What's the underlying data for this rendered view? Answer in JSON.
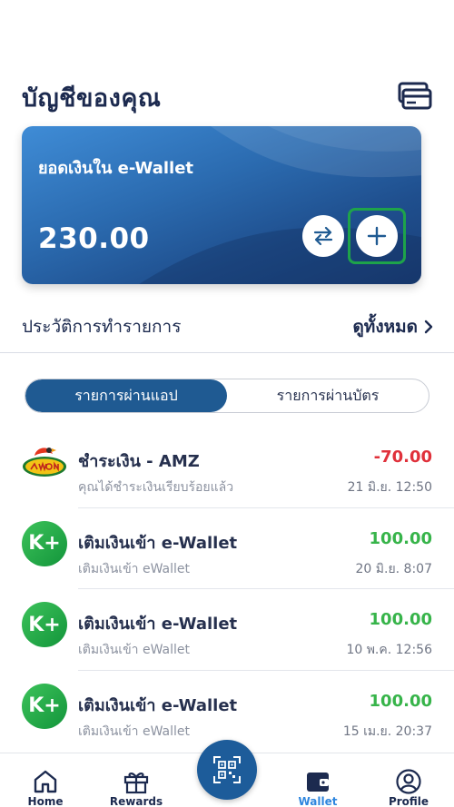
{
  "header": {
    "title": "บัญชีของคุณ",
    "cards_icon": "credit-cards-icon"
  },
  "wallet_card": {
    "label": "ยอดเงินใน e-Wallet",
    "balance": "230.00",
    "transfer_icon": "transfer-arrows-icon",
    "topup_icon": "plus-icon"
  },
  "history": {
    "title": "ประวัติการทำรายการ",
    "see_all": "ดูทั้งหมด"
  },
  "tabs": [
    {
      "label": "รายการผ่านแอป",
      "active": true
    },
    {
      "label": "รายการผ่านบัตร",
      "active": false
    }
  ],
  "transactions": [
    {
      "logo": "amazon-cafe-logo",
      "title": "ชำระเงิน - AMZ",
      "subtitle": "คุณได้ชำระเงินเรียบร้อยแล้ว",
      "amount": "-70.00",
      "type": "negative",
      "date": "21 มิ.ย. 12:50"
    },
    {
      "logo": "kplus-logo",
      "title": "เติมเงินเข้า e-Wallet",
      "subtitle": "เติมเงินเข้า eWallet",
      "amount": "100.00",
      "type": "positive",
      "date": "20 มิ.ย. 8:07"
    },
    {
      "logo": "kplus-logo",
      "title": "เติมเงินเข้า e-Wallet",
      "subtitle": "เติมเงินเข้า eWallet",
      "amount": "100.00",
      "type": "positive",
      "date": "10 พ.ค. 12:56"
    },
    {
      "logo": "kplus-logo",
      "title": "เติมเงินเข้า e-Wallet",
      "subtitle": "เติมเงินเข้า eWallet",
      "amount": "100.00",
      "type": "positive",
      "date": "15 เม.ย. 20:37"
    }
  ],
  "bottom_nav": {
    "items": [
      {
        "label": "Home",
        "icon": "home-icon",
        "active": false
      },
      {
        "label": "Rewards",
        "icon": "gift-icon",
        "active": false
      },
      {
        "label": "Wallet",
        "icon": "wallet-icon",
        "active": true
      },
      {
        "label": "Profile",
        "icon": "profile-icon",
        "active": false
      }
    ],
    "scan_icon": "qr-scan-icon"
  },
  "colors": {
    "primary": "#1d5c9a",
    "negative": "#e0313b",
    "positive": "#37b44a",
    "highlight": "#1ea34a",
    "active_nav": "#2e86de"
  }
}
